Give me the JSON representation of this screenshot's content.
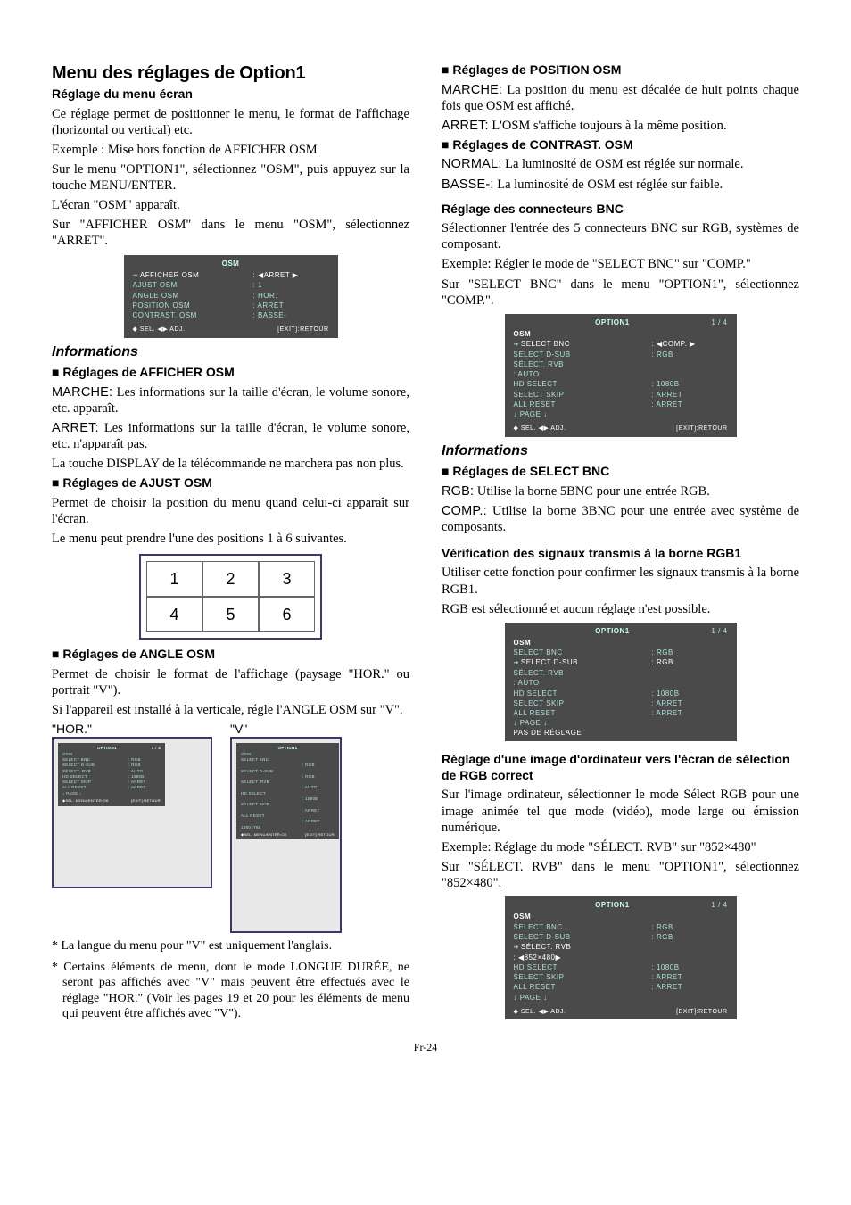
{
  "pageNumber": "Fr-24",
  "left": {
    "title": "Menu des réglages de Option1",
    "subtitle": "Réglage du menu écran",
    "intro1": "Ce réglage permet de positionner le menu, le format de l'affichage (horizontal ou vertical) etc.",
    "example1": "Exemple : Mise hors fonction de  AFFICHER OSM",
    "step1": "Sur le menu \"OPTION1\", sélectionnez \"OSM\", puis appuyez sur la touche MENU/ENTER.",
    "step2": "L'écran \"OSM\" apparaît.",
    "step3": "Sur \"AFFICHER OSM\" dans le menu \"OSM\", sélectionnez \"ARRET\".",
    "osm1": {
      "title": "OSM",
      "rows": [
        {
          "k": "AFFICHER OSM",
          "v": ":  ◀ARRET  ▶",
          "hl": true,
          "arrow": true
        },
        {
          "k": "AJUST OSM",
          "v": ":   1"
        },
        {
          "k": "ANGLE OSM",
          "v": ":   HOR."
        },
        {
          "k": "POSITION OSM",
          "v": ":   ARRET"
        },
        {
          "k": "CONTRAST. OSM",
          "v": ":   BASSE-"
        }
      ],
      "foot": {
        "l": "◆ SEL.       ◀▶ ADJ.",
        "r": "[EXIT]:RETOUR"
      }
    },
    "infoTitle": "Informations",
    "afficherHead": "Réglages de AFFICHER OSM",
    "marcheLabel": "MARCHE:",
    "marcheText": " Les informations sur la taille d'écran, le volume sonore, etc. apparaît.",
    "arretLabel": "ARRET:",
    "arretText": " Les informations sur la taille d'écran, le volume sonore, etc. n'apparaît pas.",
    "displayNote": "La touche DISPLAY de la télécommande ne marchera pas non plus.",
    "ajustHead": "Réglages de AJUST OSM",
    "ajustP1": "Permet de choisir la position du menu quand celui-ci apparaît sur l'écran.",
    "ajustP2": "Le menu peut prendre l'une des positions 1 à 6 suivantes.",
    "grid": [
      "1",
      "2",
      "3",
      "4",
      "5",
      "6"
    ],
    "angleHead": "Réglages de ANGLE OSM",
    "angleP1": "Permet de choisir le format de l'affichage (paysage \"HOR.\" ou portrait \"V\").",
    "angleP2": "Si l'appareil est installé à la verticale, régle l'ANGLE OSM sur \"V\".",
    "horLabel": "\"HOR.\"",
    "vLabel": "\"V\"",
    "miniH": {
      "title": "OPTION1",
      "page": "1 / 4",
      "rows": [
        {
          "k": "OSM",
          "v": ""
        },
        {
          "k": "SELECT BNC",
          "v": ": RGB"
        },
        {
          "k": "SELECT D-SUB",
          "v": ": RGB"
        },
        {
          "k": "SÉLECT. RVB",
          "v": ": AUTO"
        },
        {
          "k": "HD SELECT",
          "v": ": 1080B"
        },
        {
          "k": "SELECT SKIP",
          "v": ": ARRET"
        },
        {
          "k": "ALL RESET",
          "v": ": ARRET"
        },
        {
          "k": "↓ PAGE ↓",
          "v": ""
        }
      ],
      "foot": {
        "l": "◆SEL. MENU/ENTER:OK",
        "r": "[EXIT]:RETOUR"
      }
    },
    "miniV": {
      "title": "OPTION1",
      "rows": [
        {
          "k": "OSM",
          "v": ""
        },
        {
          "k": "SELECT BNC",
          "v": ""
        },
        {
          "k": "",
          "v": ": RGB"
        },
        {
          "k": "SELECT D-SUB",
          "v": ""
        },
        {
          "k": "",
          "v": ": RGB"
        },
        {
          "k": "SÉLECT. RVB",
          "v": ""
        },
        {
          "k": "",
          "v": ": AUTO"
        },
        {
          "k": "HD SELECT",
          "v": ""
        },
        {
          "k": "",
          "v": ": 1080B"
        },
        {
          "k": "SELECT SKIP",
          "v": ""
        },
        {
          "k": "",
          "v": ": ARRET"
        },
        {
          "k": "ALL RESET",
          "v": ""
        },
        {
          "k": "",
          "v": ": ARRET"
        },
        {
          "k": " 1360×768",
          "v": ""
        }
      ],
      "foot": {
        "l": "◆SEL. MENU/ENTER:OK",
        "r": "[EXIT]:RETOUR"
      }
    },
    "fn1": "* La langue du menu pour \"V\" est uniquement l'anglais.",
    "fn2": "* Certains éléments de menu, dont le mode LONGUE DURÉE, ne seront pas affichés avec \"V\" mais peuvent être effectués avec le réglage \"HOR.\" (Voir les pages 19 et 20 pour les éléments de menu qui peuvent être affichés avec \"V\")."
  },
  "right": {
    "posHead": "Réglages de POSITION OSM",
    "posMarLabel": "MARCHE:",
    "posMarText": " La position du menu est décalée de huit points chaque fois que OSM est affiché.",
    "posArrLabel": "ARRET:",
    "posArrText": " L'OSM s'affiche toujours à la même position.",
    "contHead": "Réglages de CONTRAST. OSM",
    "normLabel": "NORMAL:",
    "normText": " La luminosité de OSM est réglée sur normale.",
    "basseLabel": "BASSE-:",
    "basseText": " La luminosité de OSM est réglée sur faible.",
    "bncTitle": "Réglage des connecteurs BNC",
    "bncP1": "Sélectionner l'entrée des 5 connecteurs BNC sur RGB, systèmes de composant.",
    "bncEx": "Exemple: Régler le mode de \"SELECT BNC\" sur \"COMP.\"",
    "bncP2": "Sur \"SELECT BNC\" dans le menu \"OPTION1\", sélectionnez \"COMP.\".",
    "osm2": {
      "title": "OPTION1",
      "page": "1 / 4",
      "rows": [
        {
          "k": "OSM",
          "v": "",
          "head": true
        },
        {
          "k": "SELECT BNC",
          "v": ":  ◀COMP.  ▶",
          "hl": true,
          "arrow": true
        },
        {
          "k": "SELECT D-SUB",
          "v": ":   RGB"
        },
        {
          "k": "SÉLECT. RVB",
          "v": ""
        },
        {
          "k": "          :  AUTO",
          "v": ""
        },
        {
          "k": "HD SELECT",
          "v": ":   1080B"
        },
        {
          "k": "SELECT SKIP",
          "v": ":   ARRET"
        },
        {
          "k": "ALL RESET",
          "v": ":   ARRET"
        },
        {
          "k": "  ↓ PAGE ↓",
          "v": ""
        }
      ],
      "foot": {
        "l": "◆ SEL.       ◀▶ ADJ.",
        "r": "[EXIT]:RETOUR"
      }
    },
    "infoTitle2": "Informations",
    "selHead": "Réglages de SELECT BNC",
    "rgbLabel": "RGB:",
    "rgbText": " Utilise la borne 5BNC pour une entrée RGB.",
    "compLabel": "COMP.:",
    "compText": " Utilise la borne 3BNC pour une entrée avec système de composants.",
    "verifTitle": "Vérification des signaux transmis à la borne RGB1",
    "verifP1": "Utiliser cette fonction pour confirmer les signaux transmis à la borne RGB1.",
    "verifP2": "RGB est sélectionné et aucun réglage n'est possible.",
    "osm3": {
      "title": "OPTION1",
      "page": "1 / 4",
      "rows": [
        {
          "k": "OSM",
          "v": "",
          "head": true
        },
        {
          "k": "SELECT BNC",
          "v": ":   RGB"
        },
        {
          "k": "SELECT D-SUB",
          "v": ":   RGB",
          "hl": true,
          "arrow": true
        },
        {
          "k": "SÉLECT. RVB",
          "v": ""
        },
        {
          "k": "          :  AUTO",
          "v": ""
        },
        {
          "k": "HD SELECT",
          "v": ":   1080B"
        },
        {
          "k": "SELECT SKIP",
          "v": ":   ARRET"
        },
        {
          "k": "ALL RESET",
          "v": ":   ARRET"
        },
        {
          "k": "  ↓ PAGE ↓",
          "v": ""
        },
        {
          "k": "PAS DE RÉGLAGE",
          "v": "",
          "hl": true
        }
      ],
      "foot": null
    },
    "rvbTitle": "Réglage d'une image d'ordinateur vers l'écran de sélection de RGB correct",
    "rvbP1": "Sur l'image ordinateur, sélectionner le mode Sélect RGB pour une image animée tel que mode (vidéo), mode large ou émission numérique.",
    "rvbEx": "Exemple: Réglage du mode \"SÉLECT. RVB\" sur \"852×480\"",
    "rvbP2": "Sur \"SÉLECT. RVB\" dans le menu \"OPTION1\", sélectionnez \"852×480\".",
    "osm4": {
      "title": "OPTION1",
      "page": "1 / 4",
      "rows": [
        {
          "k": "OSM",
          "v": "",
          "head": true
        },
        {
          "k": "SELECT BNC",
          "v": ":   RGB"
        },
        {
          "k": "SELECT D-SUB",
          "v": ":   RGB"
        },
        {
          "k": "SÉLECT. RVB",
          "v": "",
          "hl": true,
          "arrow": true
        },
        {
          "k": "              :  ◀852×480▶",
          "v": "",
          "hl": true
        },
        {
          "k": "HD SELECT",
          "v": ":   1080B"
        },
        {
          "k": "SELECT SKIP",
          "v": ":   ARRET"
        },
        {
          "k": "ALL RESET",
          "v": ":   ARRET"
        },
        {
          "k": "  ↓ PAGE ↓",
          "v": ""
        }
      ],
      "foot": {
        "l": "◆ SEL.       ◀▶ ADJ.",
        "r": "[EXIT]:RETOUR"
      }
    }
  }
}
